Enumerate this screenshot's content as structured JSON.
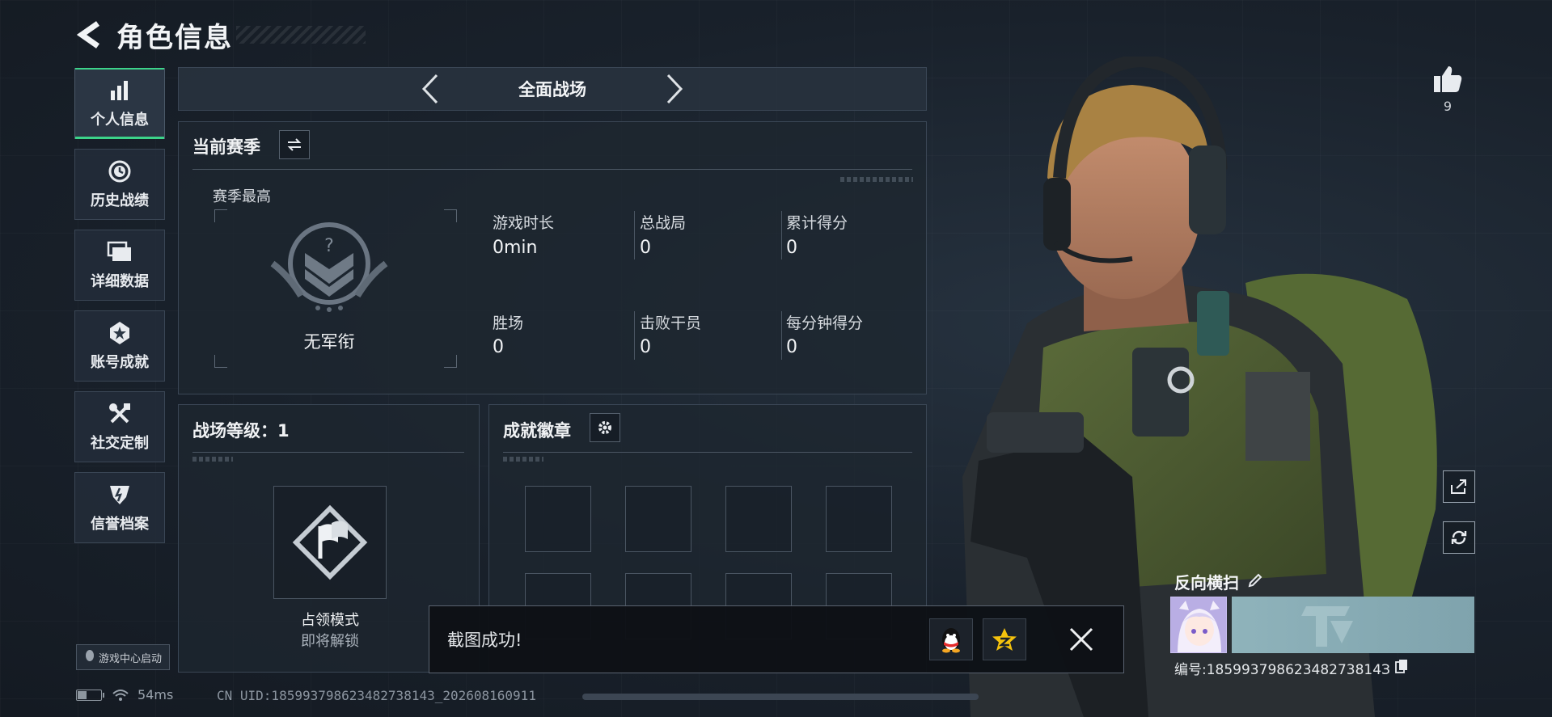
{
  "header": {
    "title": "角色信息"
  },
  "nav": {
    "items": [
      {
        "label": "个人信息",
        "icon": "bar-chart-icon",
        "active": true
      },
      {
        "label": "历史战绩",
        "icon": "clock-icon",
        "active": false
      },
      {
        "label": "详细数据",
        "icon": "folders-icon",
        "active": false
      },
      {
        "label": "账号成就",
        "icon": "medal-icon",
        "active": false
      },
      {
        "label": "社交定制",
        "icon": "tools-icon",
        "active": false
      },
      {
        "label": "信誉档案",
        "icon": "shield-icon",
        "active": false
      }
    ],
    "launch_badge": "游戏中心启动"
  },
  "mode_bar": {
    "label": "全面战场"
  },
  "season": {
    "title": "当前赛季",
    "subtitle": "赛季最高",
    "rank_name": "无军衔",
    "stats": [
      {
        "label": "游戏时长",
        "value": "0min"
      },
      {
        "label": "总战局",
        "value": "0"
      },
      {
        "label": "累计得分",
        "value": "0"
      },
      {
        "label": "胜场",
        "value": "0"
      },
      {
        "label": "击败干员",
        "value": "0"
      },
      {
        "label": "每分钟得分",
        "value": "0"
      }
    ]
  },
  "battlefield": {
    "level_label": "战场等级：1",
    "mode_name": "占领模式",
    "mode_status": "即将解锁"
  },
  "achievements": {
    "title": "成就徽章"
  },
  "toast": {
    "text": "截图成功!"
  },
  "status": {
    "ping": "54ms",
    "battery_level": 0.35
  },
  "uid_text": "CN UID:18599379862348273814З_202608160911",
  "profile": {
    "likes": "9",
    "player_name": "反向横扫",
    "player_id": "编号:18599379862348273814З"
  },
  "colors": {
    "accent": "#3cd48a",
    "panel": "#1e2630",
    "border": "#3a4655"
  }
}
